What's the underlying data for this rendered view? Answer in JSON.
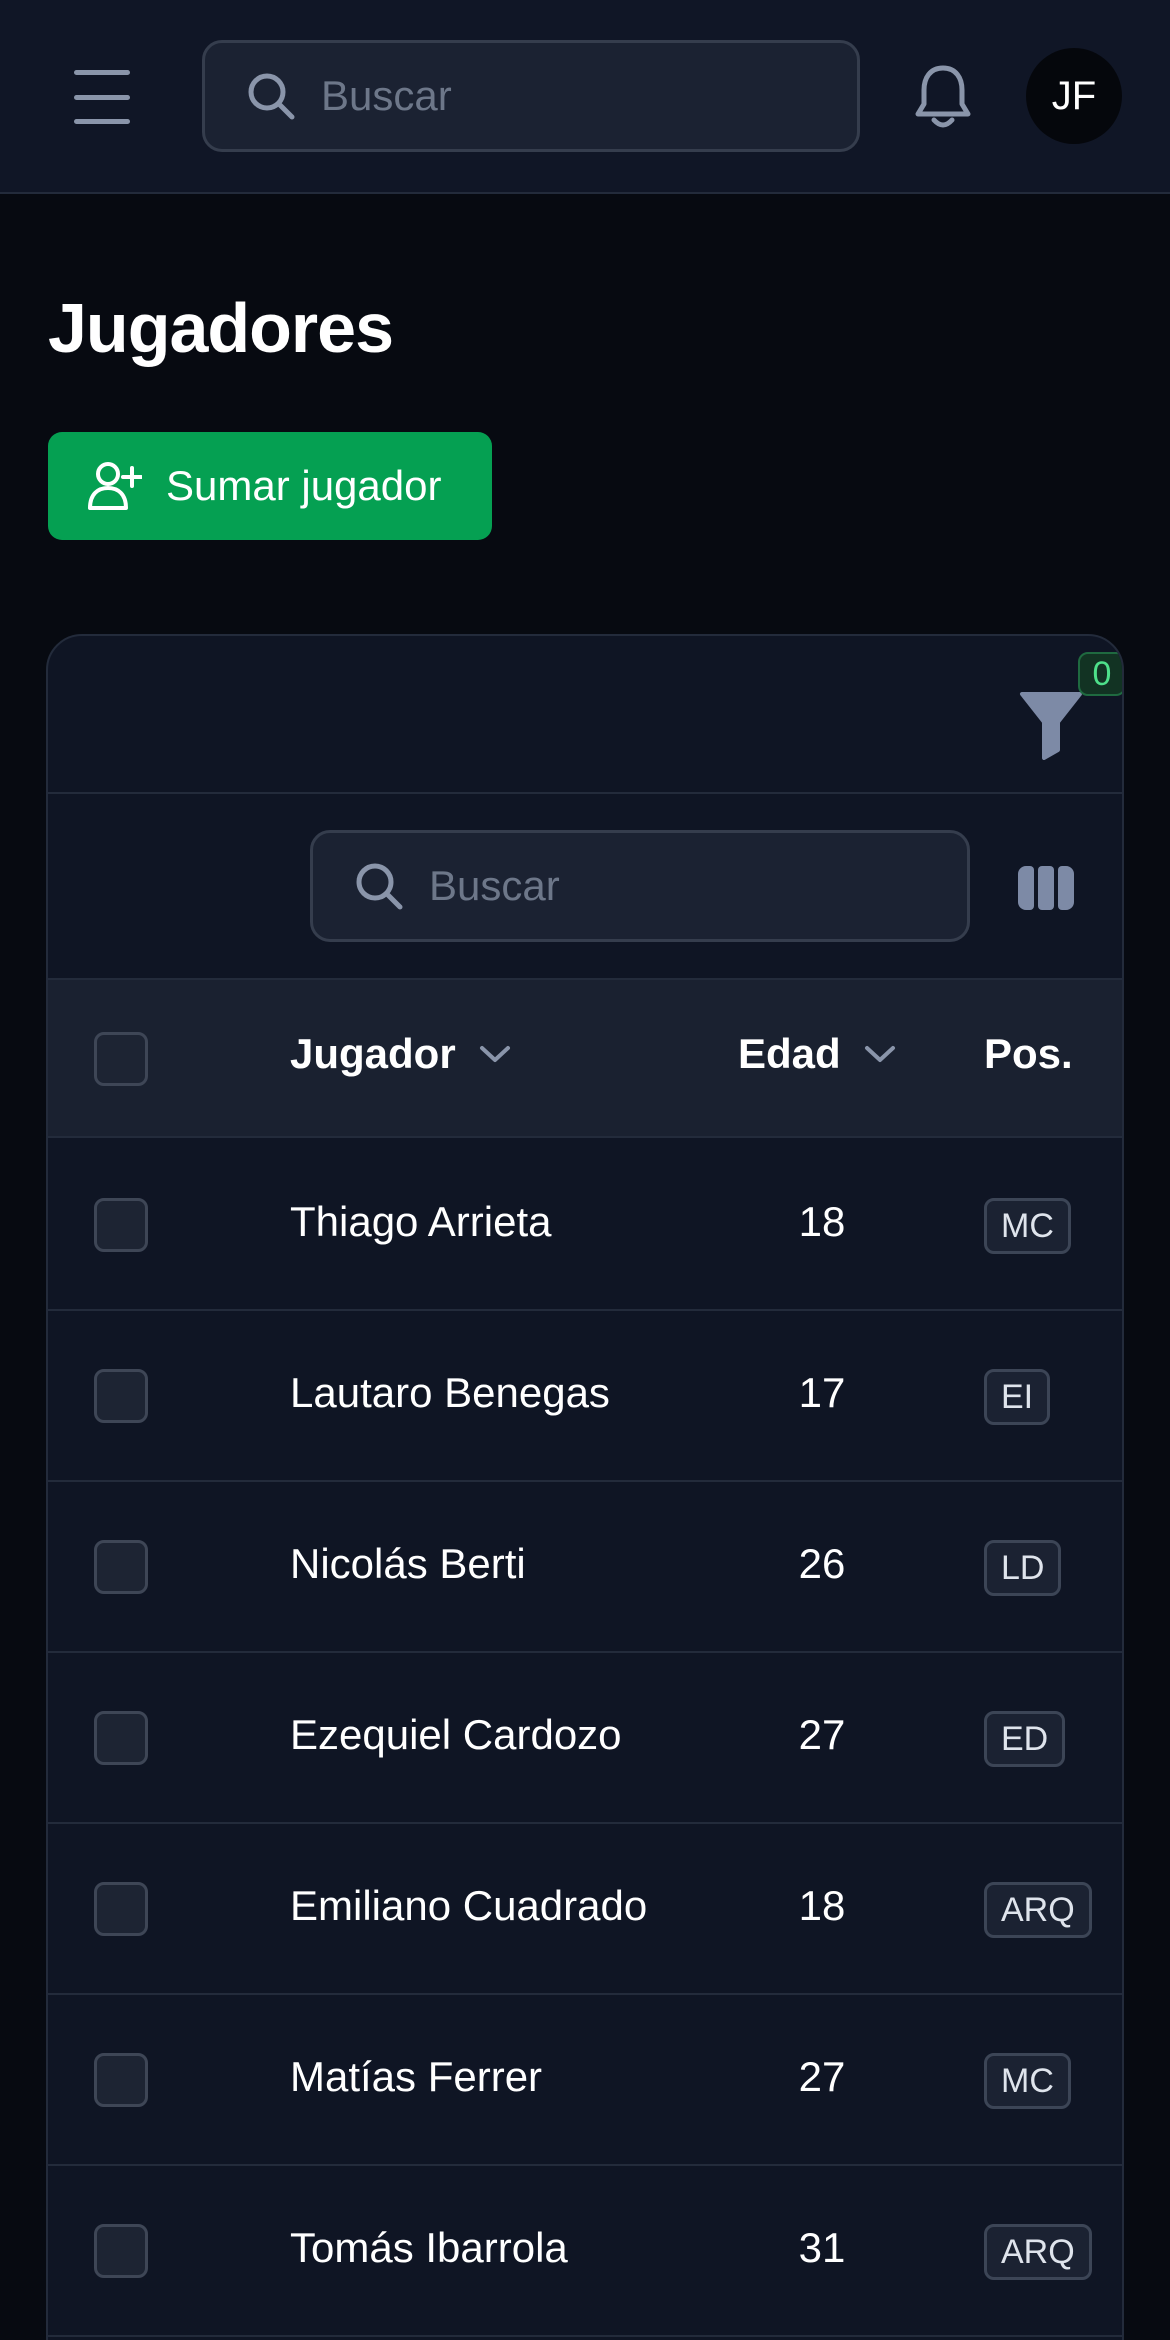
{
  "topbar": {
    "search_placeholder": "Buscar",
    "avatar_initials": "JF"
  },
  "page": {
    "title": "Jugadores",
    "add_button_label": "Sumar jugador"
  },
  "table": {
    "filter_count": "0",
    "search_placeholder": "Buscar",
    "headers": {
      "player": "Jugador",
      "age": "Edad",
      "position": "Pos."
    },
    "rows": [
      {
        "name": "Thiago Arrieta",
        "age": "18",
        "position": "MC"
      },
      {
        "name": "Lautaro Benegas",
        "age": "17",
        "position": "EI"
      },
      {
        "name": "Nicolás Berti",
        "age": "26",
        "position": "LD"
      },
      {
        "name": "Ezequiel Cardozo",
        "age": "27",
        "position": "ED"
      },
      {
        "name": "Emiliano Cuadrado",
        "age": "18",
        "position": "ARQ"
      },
      {
        "name": "Matías Ferrer",
        "age": "27",
        "position": "MC"
      },
      {
        "name": "Tomás Ibarrola",
        "age": "31",
        "position": "ARQ"
      }
    ]
  },
  "colors": {
    "background": "#070a11",
    "surface": "#0f1524",
    "primary_button": "#05a052",
    "filter_badge_text": "#4ee08a"
  },
  "icons": [
    "menu-icon",
    "search-icon",
    "bell-icon",
    "user-plus-icon",
    "filter-icon",
    "columns-icon",
    "chevron-down-icon"
  ]
}
